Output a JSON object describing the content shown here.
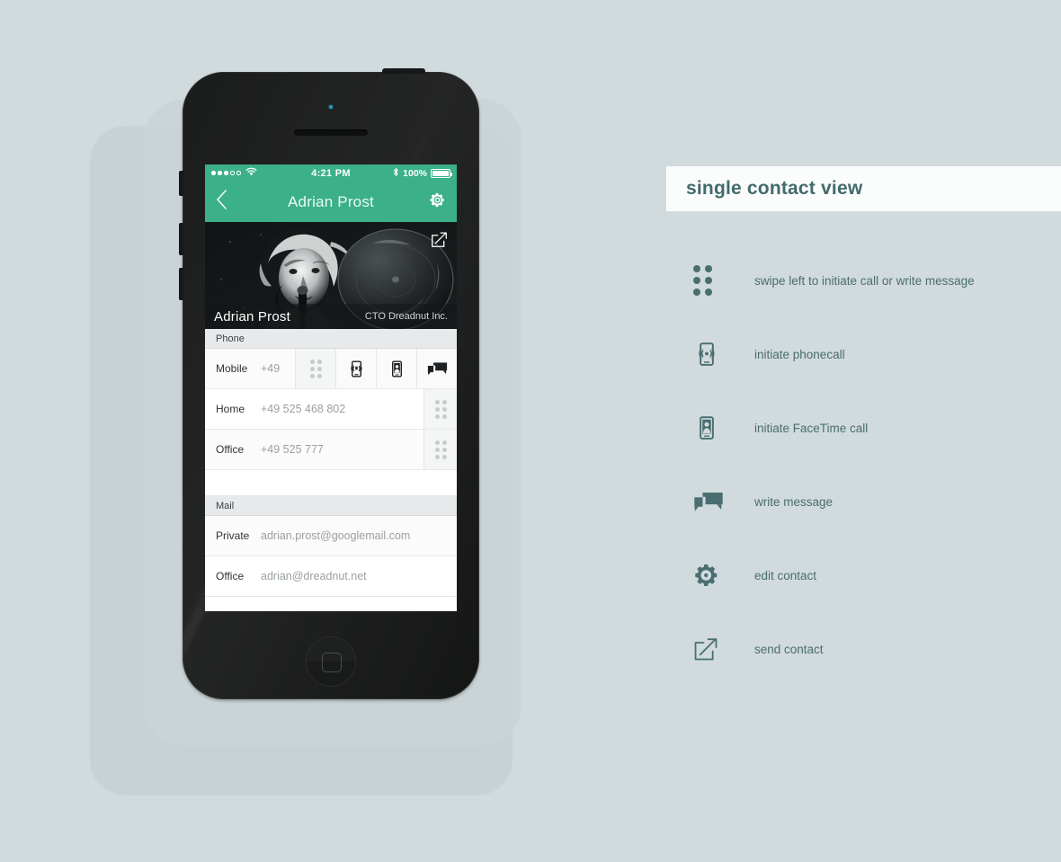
{
  "canvas": {
    "background_color": "#d1dadd"
  },
  "phone": {
    "status_bar": {
      "signal_dots_filled": 3,
      "signal_dots_total": 5,
      "wifi_icon": "wifi-icon",
      "time": "4:21 PM",
      "bluetooth_icon": "bluetooth-icon",
      "battery_percent": "100%",
      "battery_icon": "battery-full-icon"
    },
    "nav_bar": {
      "back_icon": "chevron-left-icon",
      "title": "Adrian Prost",
      "settings_icon": "gear-icon",
      "accent_color": "#3bb089"
    },
    "hero": {
      "name": "Adrian Prost",
      "role": "CTO Dreadnut Inc.",
      "send_icon": "send-contact-icon"
    },
    "sections": [
      {
        "header": "Phone",
        "rows": [
          {
            "label": "Mobile",
            "value": "+49",
            "swiped": true,
            "actions": [
              {
                "name": "grip-handle-icon"
              },
              {
                "name": "phone-call-icon"
              },
              {
                "name": "facetime-icon"
              },
              {
                "name": "message-icon"
              }
            ]
          },
          {
            "label": "Home",
            "value": "+49 525 468 802",
            "swiped": false
          },
          {
            "label": "Office",
            "value": "+49 525 777",
            "swiped": false
          }
        ]
      },
      {
        "header": "Mail",
        "rows": [
          {
            "label": "Private",
            "value": "adrian.prost@googlemail.com",
            "swiped": false
          },
          {
            "label": "Office",
            "value": "adrian@dreadnut.net",
            "swiped": false
          }
        ]
      }
    ]
  },
  "legend": {
    "title": "single contact view",
    "text_color": "#426b6b",
    "items": [
      {
        "icon": "grip-handle-icon",
        "label": "swipe left to initiate call or write message"
      },
      {
        "icon": "phone-call-icon",
        "label": "initiate phonecall"
      },
      {
        "icon": "facetime-icon",
        "label": "initiate FaceTime call"
      },
      {
        "icon": "message-icon",
        "label": "write message"
      },
      {
        "icon": "gear-icon",
        "label": "edit contact"
      },
      {
        "icon": "send-contact-icon",
        "label": "send contact"
      }
    ]
  }
}
